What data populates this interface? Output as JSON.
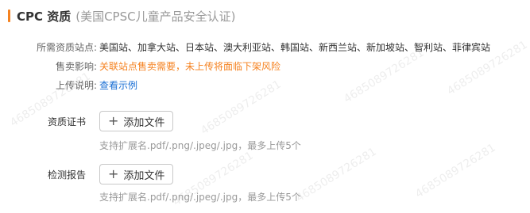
{
  "header": {
    "title": "CPC 资质",
    "subtitle": "(美国CPSC儿童产品安全认证)"
  },
  "info": {
    "sites_label": "所需资质站点:",
    "sites_value": "美国站、加拿大站、日本站、澳大利亚站、韩国站、新西兰站、新加坡站、智利站、菲律宾站",
    "impact_label": "售卖影响:",
    "impact_value": "关联站点售卖需要，未上传将面临下架风险",
    "upload_label": "上传说明:",
    "upload_link": "查看示例"
  },
  "fields": {
    "cert": {
      "label": "资质证书",
      "button": "添加文件",
      "hint": "支持扩展名.pdf/.png/.jpeg/.jpg，最多上传5个"
    },
    "report": {
      "label": "检测报告",
      "button": "添加文件",
      "hint": "支持扩展名.pdf/.png/.jpeg/.jpg，最多上传5个"
    }
  },
  "watermark": "4685089726281",
  "colors": {
    "accent": "#f58220",
    "warning": "#f58220",
    "link": "#1a6fd4"
  }
}
